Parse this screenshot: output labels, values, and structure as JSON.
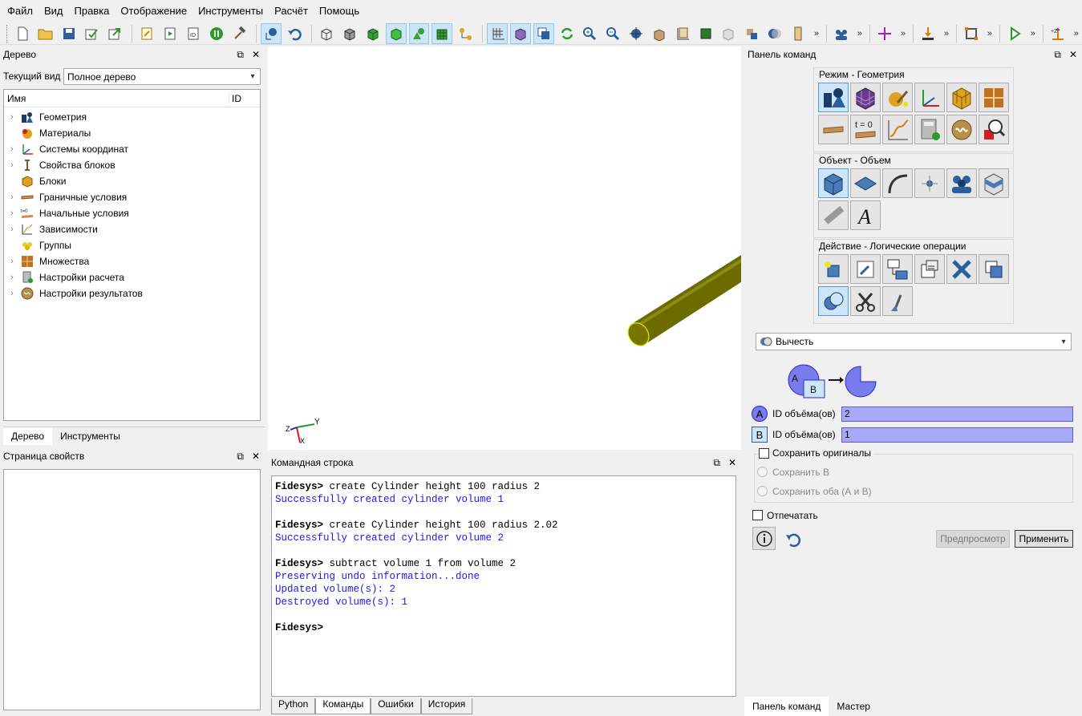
{
  "menu": [
    "Файл",
    "Вид",
    "Правка",
    "Отображение",
    "Инструменты",
    "Расчёт",
    "Помощь"
  ],
  "tree_panel": {
    "title": "Дерево",
    "view_label": "Текущий вид",
    "view_value": "Полное дерево",
    "col_name": "Имя",
    "col_id": "ID",
    "items": [
      {
        "label": "Геометрия",
        "icon": "geometry-icon",
        "expand": true
      },
      {
        "label": "Материалы",
        "icon": "materials-icon",
        "expand": false
      },
      {
        "label": "Системы координат",
        "icon": "coordinate-system-icon",
        "expand": true
      },
      {
        "label": "Свойства блоков",
        "icon": "block-properties-icon",
        "expand": true
      },
      {
        "label": "Блоки",
        "icon": "blocks-icon",
        "expand": false
      },
      {
        "label": "Граничные условия",
        "icon": "boundary-conditions-icon",
        "expand": true
      },
      {
        "label": "Начальные условия",
        "icon": "initial-conditions-icon",
        "expand": true
      },
      {
        "label": "Зависимости",
        "icon": "dependencies-icon",
        "expand": true
      },
      {
        "label": "Группы",
        "icon": "groups-icon",
        "expand": false
      },
      {
        "label": "Множества",
        "icon": "sets-icon",
        "expand": true
      },
      {
        "label": "Настройки расчета",
        "icon": "calc-settings-icon",
        "expand": true
      },
      {
        "label": "Настройки результатов",
        "icon": "result-settings-icon",
        "expand": true
      }
    ],
    "tabs": [
      "Дерево",
      "Инструменты"
    ]
  },
  "props_panel": {
    "title": "Страница свойств"
  },
  "viewport": {
    "axis_y": "Y",
    "axis_z": "Z",
    "axis_x": "X"
  },
  "console": {
    "title": "Командная строка",
    "lines": [
      {
        "prompt": "Fidesys>",
        "cmd": " create Cylinder height 100 radius 2"
      },
      {
        "out": "Successfully created cylinder volume 1"
      },
      {
        "blank": ""
      },
      {
        "prompt": "Fidesys>",
        "cmd": " create Cylinder height 100 radius 2.02"
      },
      {
        "out": "Successfully created cylinder volume 2"
      },
      {
        "blank": ""
      },
      {
        "prompt": "Fidesys>",
        "cmd": " subtract volume 1 from volume 2"
      },
      {
        "out": "Preserving undo information...done"
      },
      {
        "out": "Updated volume(s): 2"
      },
      {
        "out": "Destroyed volume(s): 1"
      },
      {
        "blank": ""
      },
      {
        "prompt": "Fidesys>",
        "cmd": ""
      }
    ],
    "tabs": [
      "Python",
      "Команды",
      "Ошибки",
      "История"
    ]
  },
  "cmd_panel": {
    "title": "Панель команд",
    "mode_label": "Режим - Геометрия",
    "object_label": "Объект - Объем",
    "action_label": "Действие - Логические операции",
    "t0": "t = 0",
    "operation": "Вычесть",
    "diag_a": "A",
    "diag_b": "B",
    "field_a_label": "ID объёма(ов)",
    "field_a_value": "2",
    "field_b_label": "ID объёма(ов)",
    "field_b_value": "1",
    "keep_originals": "Сохранить оригиналы",
    "keep_b": "Сохранить B",
    "keep_both": "Сохранить оба (А и В)",
    "imprint": "Отпечатать",
    "preview": "Предпросмотр",
    "apply": "Применить",
    "tabs": [
      "Панель команд",
      "Мастер"
    ]
  },
  "colors": {
    "cylinder": "#6b6b00",
    "highlight": "#e8e800",
    "accent": "#7b7bf0"
  }
}
